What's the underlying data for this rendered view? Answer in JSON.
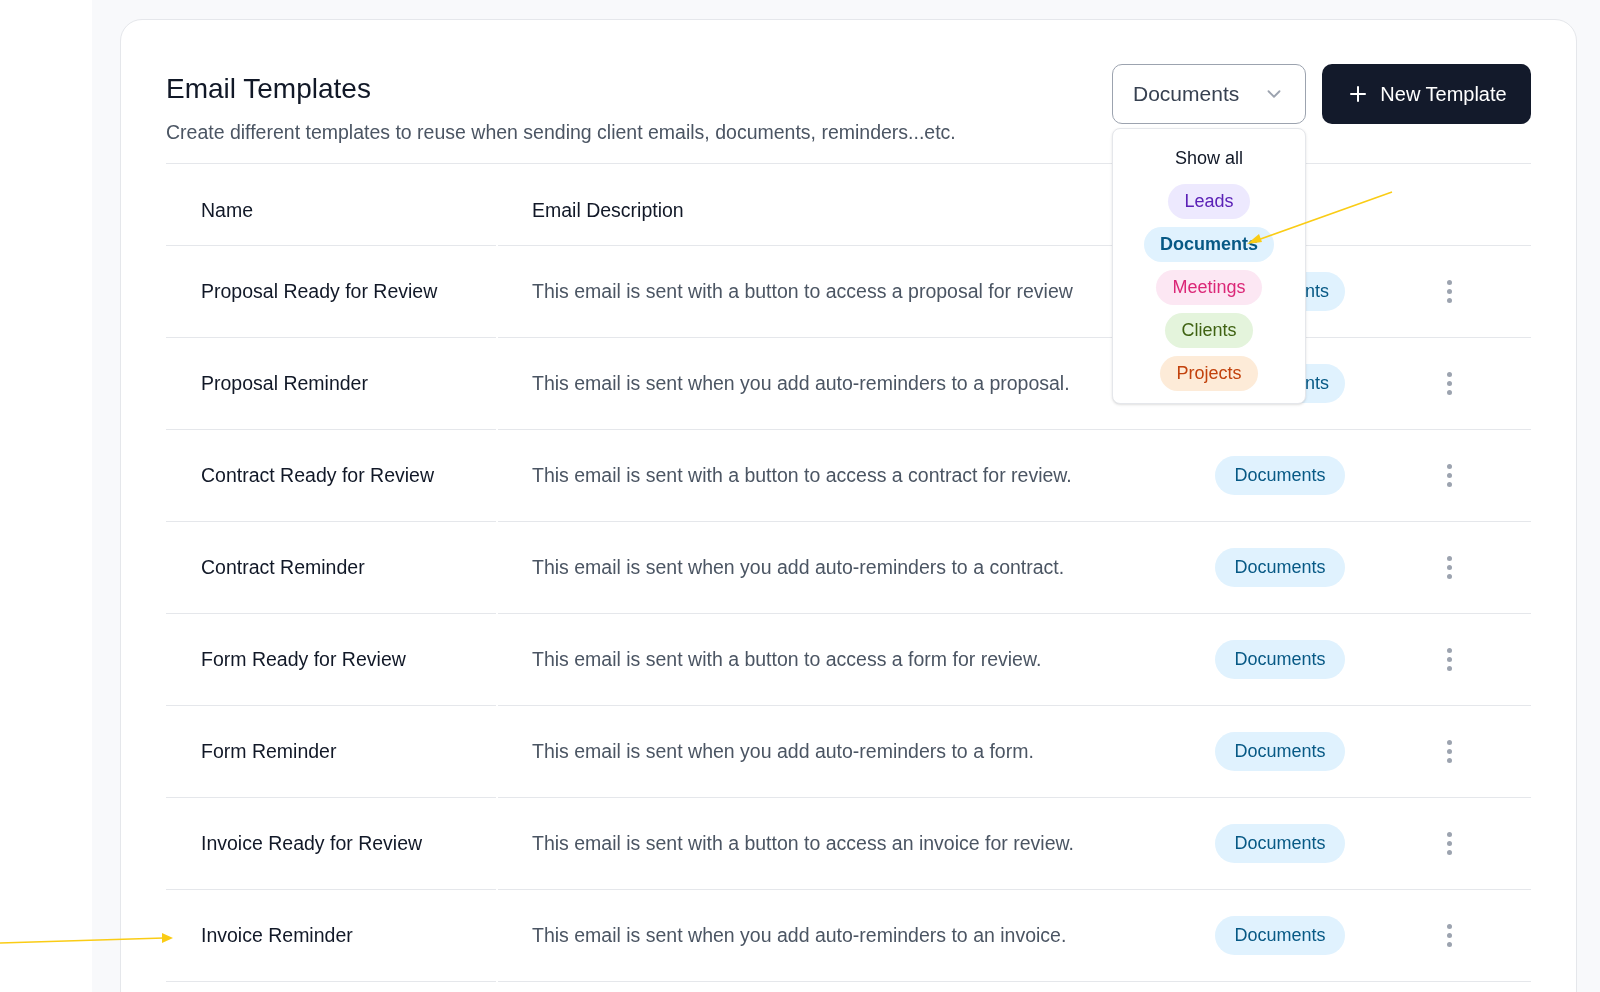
{
  "header": {
    "title": "Email Templates",
    "subtitle": "Create different templates to reuse when sending client emails, documents, reminders...etc."
  },
  "filter": {
    "value": "Documents",
    "expanded": true,
    "options": [
      {
        "label": "Show all",
        "kind": "plain",
        "selected": false
      },
      {
        "label": "Leads",
        "kind": "tag",
        "color": "#ede9fe",
        "selected": false
      },
      {
        "label": "Documents",
        "kind": "tag",
        "color": "#e0f2fe",
        "selected": true
      },
      {
        "label": "Meetings",
        "kind": "tag",
        "color": "#fce7f3",
        "selected": false
      },
      {
        "label": "Clients",
        "kind": "tag",
        "color": "#e4f4dc",
        "selected": false
      },
      {
        "label": "Projects",
        "kind": "tag",
        "color": "#fdebd8",
        "selected": false
      }
    ]
  },
  "new_button": {
    "label": "New Template"
  },
  "table": {
    "columns": [
      "Name",
      "Email Description"
    ],
    "rows": [
      {
        "name": "Proposal Ready for Review",
        "description": "This email is sent with a button to access a proposal for review",
        "tag": "nts",
        "clipped": true
      },
      {
        "name": "Proposal Reminder",
        "description": "This email is sent when you add auto-reminders to a proposal.",
        "tag": "nts",
        "clipped": true
      },
      {
        "name": "Contract Ready for Review",
        "description": "This email is sent with a button to access a contract for review.",
        "tag": "Documents",
        "clipped": false
      },
      {
        "name": "Contract Reminder",
        "description": "This email is sent when you add auto-reminders to a contract.",
        "tag": "Documents",
        "clipped": false
      },
      {
        "name": "Form Ready for Review",
        "description": "This email is sent with a button to access a form for review.",
        "tag": "Documents",
        "clipped": false
      },
      {
        "name": "Form Reminder",
        "description": "This email is sent when you add auto-reminders to a form.",
        "tag": "Documents",
        "clipped": false
      },
      {
        "name": "Invoice Ready for Review",
        "description": "This email is sent with a button to access an invoice for review.",
        "tag": "Documents",
        "clipped": false
      },
      {
        "name": "Invoice Reminder",
        "description": "This email is sent when you add auto-reminders to an invoice.",
        "tag": "Documents",
        "clipped": false
      }
    ]
  }
}
